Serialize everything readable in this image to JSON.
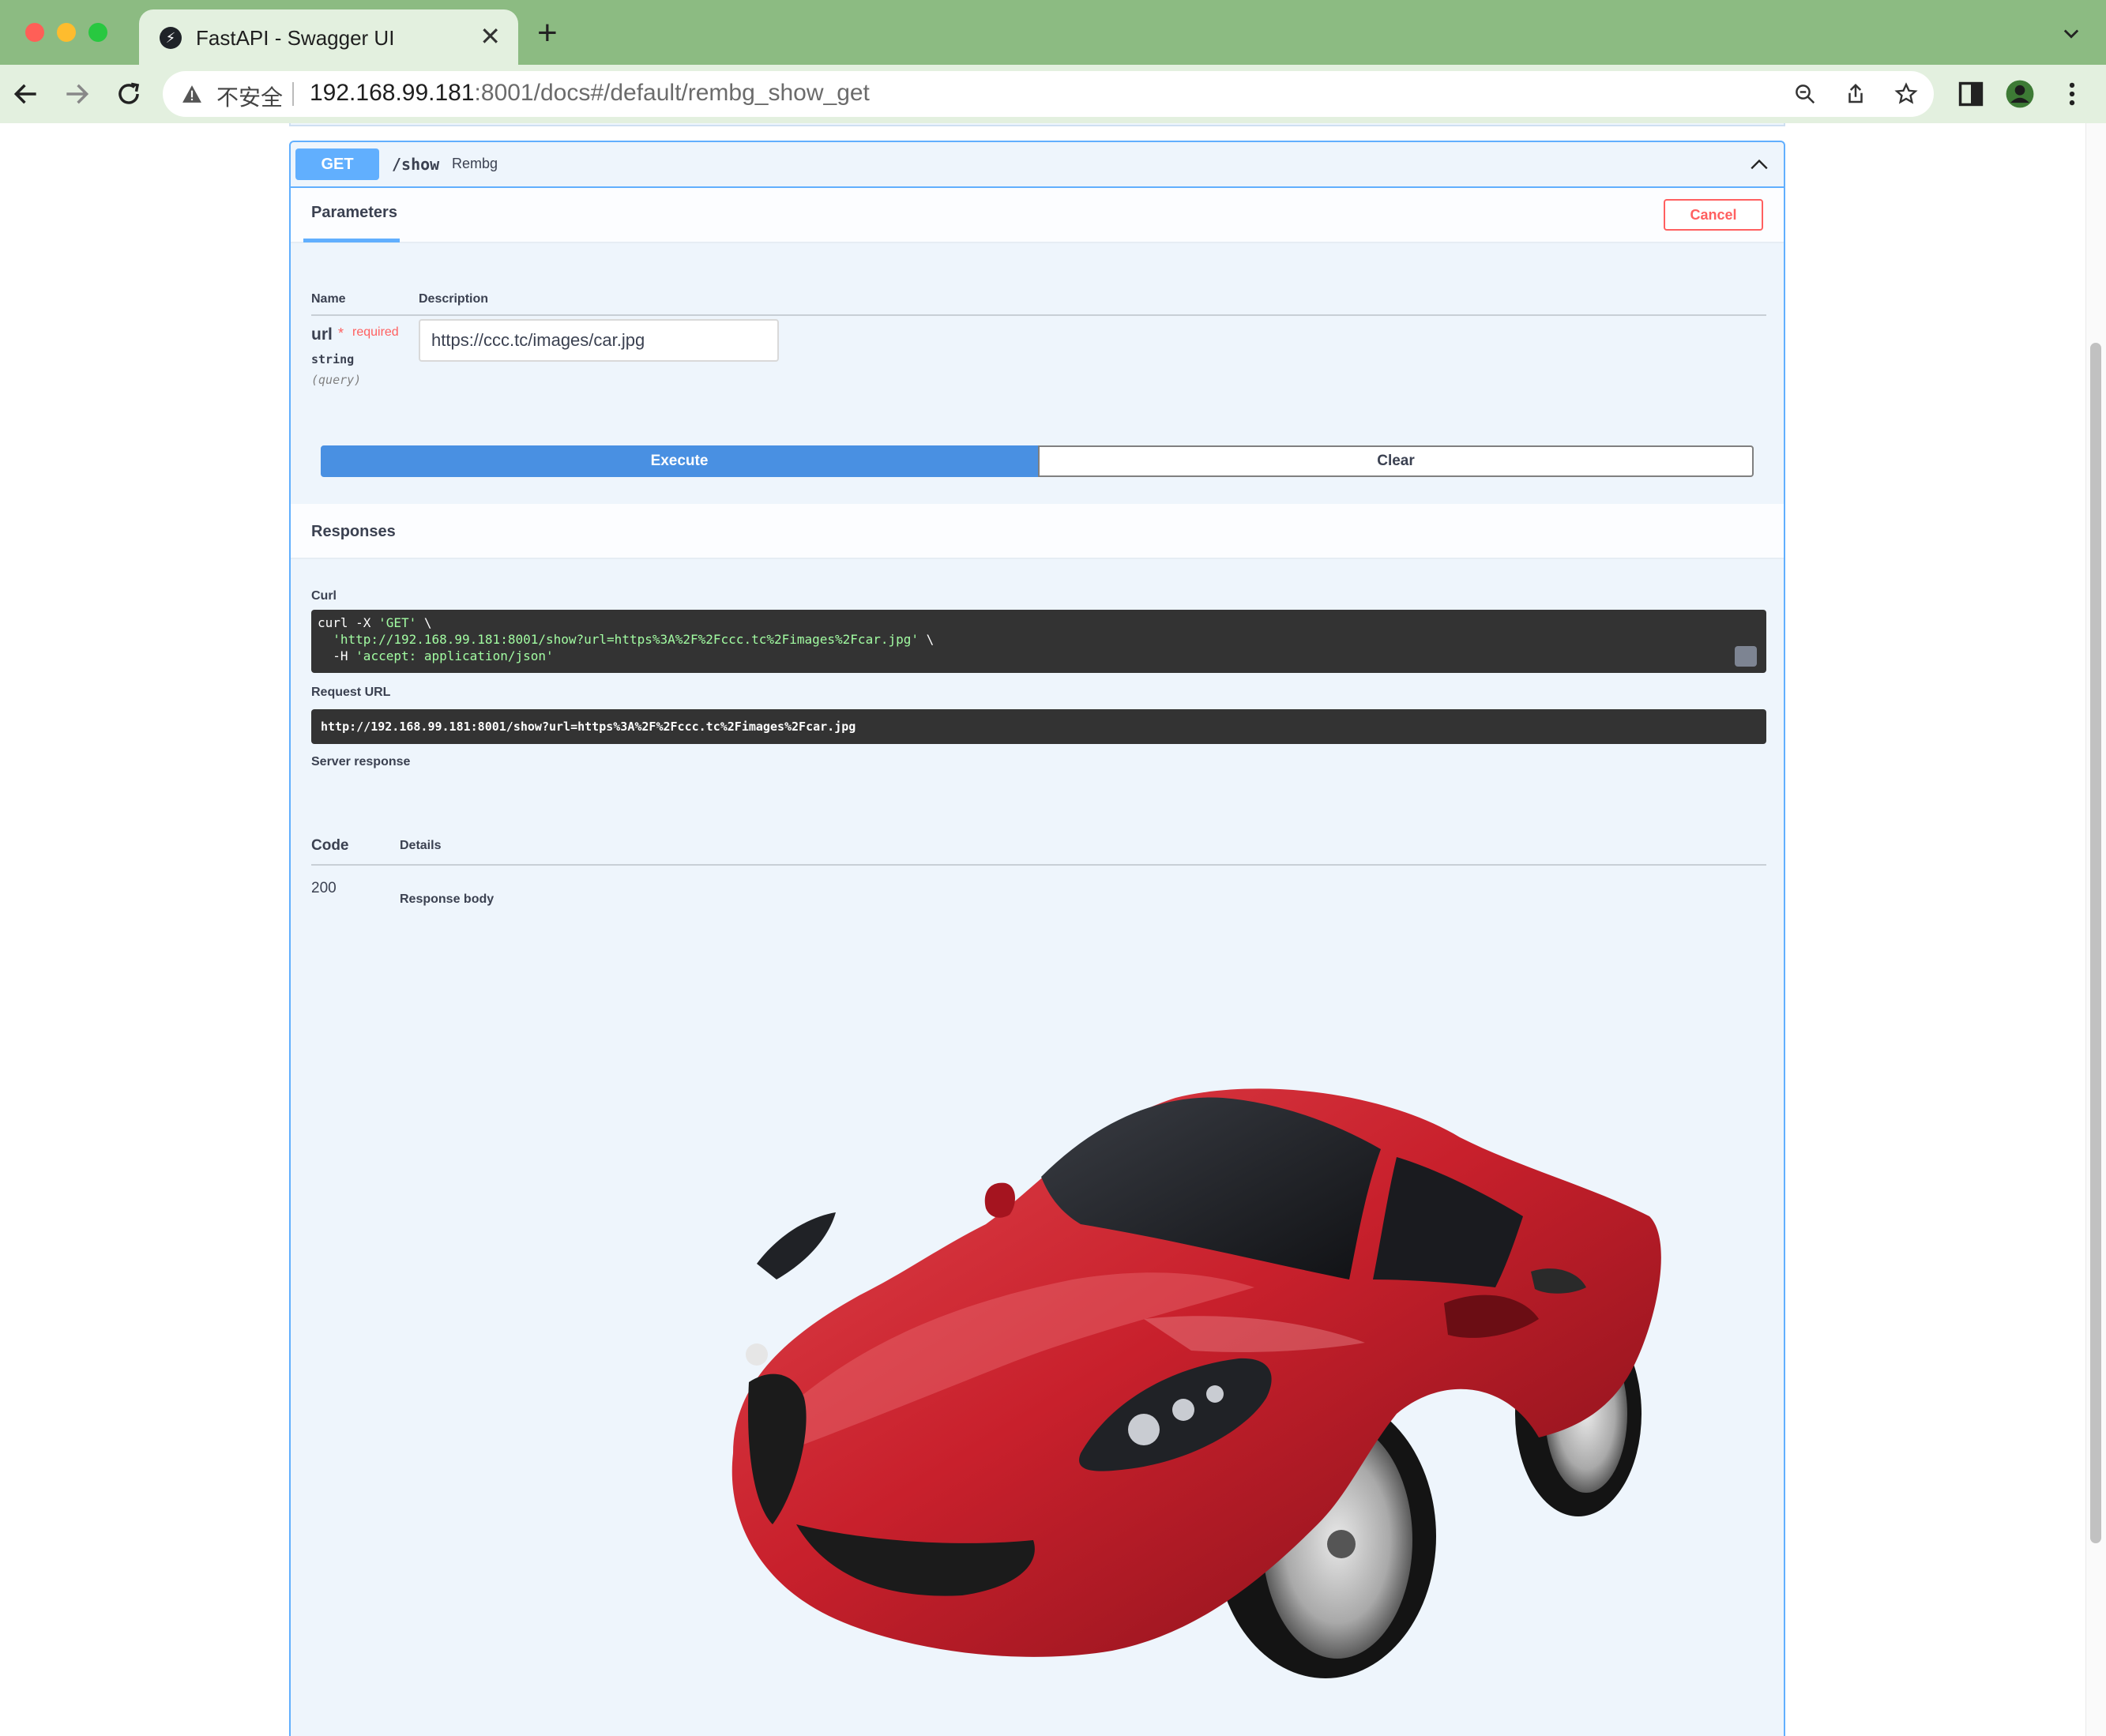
{
  "browser": {
    "tab_title": "FastAPI - Swagger UI",
    "tab_close": "✕",
    "new_tab": "+",
    "security_label": "不安全",
    "url_host": "192.168.99.181",
    "url_rest": ":8001/docs#/default/rembg_show_get"
  },
  "operation": {
    "method": "GET",
    "path": "/show",
    "summary": "Rembg",
    "parameters_tab": "Parameters",
    "cancel_label": "Cancel",
    "col_name": "Name",
    "col_description": "Description",
    "param": {
      "name": "url",
      "star": "*",
      "required_label": "required",
      "type": "string",
      "in": "(query)",
      "value": "https://ccc.tc/images/car.jpg"
    },
    "execute_label": "Execute",
    "clear_label": "Clear"
  },
  "responses": {
    "title": "Responses",
    "curl_label": "Curl",
    "curl_line1_prefix": "curl -X ",
    "curl_line1_method": "'GET'",
    "curl_line1_suffix": " \\",
    "curl_line2_url": "  'http://192.168.99.181:8001/show?url=https%3A%2F%2Fccc.tc%2Fimages%2Fcar.jpg'",
    "curl_line2_suffix": " \\",
    "curl_line3_prefix": "  -H ",
    "curl_line3_header": "'accept: application/json'",
    "request_url_label": "Request URL",
    "request_url": "http://192.168.99.181:8001/show?url=https%3A%2F%2Fccc.tc%2Fimages%2Fcar.jpg",
    "server_response_label": "Server response",
    "code_header": "Code",
    "details_header": "Details",
    "code": "200",
    "response_body_label": "Response body"
  },
  "colors": {
    "get_blue": "#61affe",
    "execute_blue": "#4990e2",
    "cancel_red": "#ff6060",
    "tab_bar_green": "#8cbb82",
    "car_red": "#c8202c"
  }
}
